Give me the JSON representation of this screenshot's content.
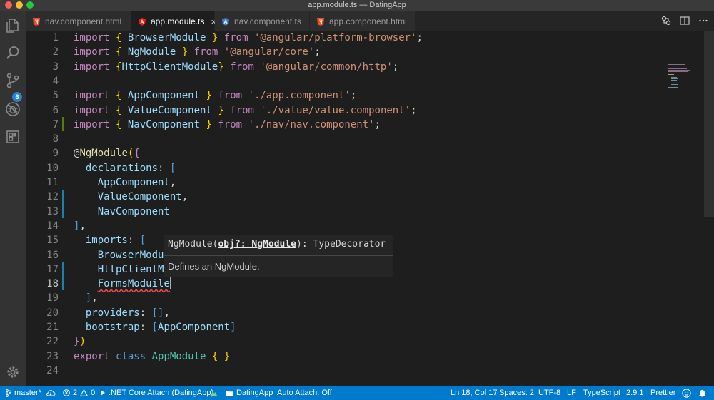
{
  "window": {
    "title": "app.module.ts — DatingApp"
  },
  "activity": {
    "scm_badge": "6"
  },
  "tabs": [
    {
      "label": "nav.component.html",
      "type": "html",
      "active": false
    },
    {
      "label": "app.module.ts",
      "type": "angular",
      "active": true,
      "close": "×"
    },
    {
      "label": "nav.component.ts",
      "type": "angular",
      "active": false
    },
    {
      "label": "app.component.html",
      "type": "html",
      "active": false
    }
  ],
  "editor": {
    "lines": [
      {
        "n": "1",
        "tokens": [
          [
            "kw",
            "import"
          ],
          [
            "pun",
            " "
          ],
          [
            "br",
            "{"
          ],
          [
            "pun",
            " "
          ],
          [
            "id",
            "BrowserModule"
          ],
          [
            "pun",
            " "
          ],
          [
            "br",
            "}"
          ],
          [
            "pun",
            " "
          ],
          [
            "kw",
            "from"
          ],
          [
            "pun",
            " "
          ],
          [
            "str",
            "'@angular/platform-browser'"
          ],
          [
            "pun",
            ";"
          ]
        ]
      },
      {
        "n": "2",
        "tokens": [
          [
            "kw",
            "import"
          ],
          [
            "pun",
            " "
          ],
          [
            "br",
            "{"
          ],
          [
            "pun",
            " "
          ],
          [
            "id",
            "NgModule"
          ],
          [
            "pun",
            " "
          ],
          [
            "br",
            "}"
          ],
          [
            "pun",
            " "
          ],
          [
            "kw",
            "from"
          ],
          [
            "pun",
            " "
          ],
          [
            "str",
            "'@angular/core'"
          ],
          [
            "pun",
            ";"
          ]
        ]
      },
      {
        "n": "3",
        "tokens": [
          [
            "kw",
            "import"
          ],
          [
            "pun",
            " "
          ],
          [
            "br",
            "{"
          ],
          [
            "id",
            "HttpClientModule"
          ],
          [
            "br",
            "}"
          ],
          [
            "pun",
            " "
          ],
          [
            "kw",
            "from"
          ],
          [
            "pun",
            " "
          ],
          [
            "str",
            "'@angular/common/http'"
          ],
          [
            "pun",
            ";"
          ]
        ]
      },
      {
        "n": "4",
        "tokens": []
      },
      {
        "n": "5",
        "tokens": [
          [
            "kw",
            "import"
          ],
          [
            "pun",
            " "
          ],
          [
            "br",
            "{"
          ],
          [
            "pun",
            " "
          ],
          [
            "id",
            "AppComponent"
          ],
          [
            "pun",
            " "
          ],
          [
            "br",
            "}"
          ],
          [
            "pun",
            " "
          ],
          [
            "kw",
            "from"
          ],
          [
            "pun",
            " "
          ],
          [
            "str",
            "'./app.component'"
          ],
          [
            "pun",
            ";"
          ]
        ]
      },
      {
        "n": "6",
        "tokens": [
          [
            "kw",
            "import"
          ],
          [
            "pun",
            " "
          ],
          [
            "br",
            "{"
          ],
          [
            "pun",
            " "
          ],
          [
            "id",
            "ValueComponent"
          ],
          [
            "pun",
            " "
          ],
          [
            "br",
            "}"
          ],
          [
            "pun",
            " "
          ],
          [
            "kw",
            "from"
          ],
          [
            "pun",
            " "
          ],
          [
            "str",
            "'./value/value.component'"
          ],
          [
            "pun",
            ";"
          ]
        ]
      },
      {
        "n": "7",
        "tokens": [
          [
            "kw",
            "import"
          ],
          [
            "pun",
            " "
          ],
          [
            "br",
            "{"
          ],
          [
            "pun",
            " "
          ],
          [
            "id",
            "NavComponent"
          ],
          [
            "pun",
            " "
          ],
          [
            "br",
            "}"
          ],
          [
            "pun",
            " "
          ],
          [
            "kw",
            "from"
          ],
          [
            "pun",
            " "
          ],
          [
            "str",
            "'./nav/nav.component'"
          ],
          [
            "pun",
            ";"
          ]
        ]
      },
      {
        "n": "8",
        "tokens": []
      },
      {
        "n": "9",
        "tokens": [
          [
            "pun",
            "@"
          ],
          [
            "dec",
            "NgModule"
          ],
          [
            "br",
            "("
          ],
          [
            "kw",
            "{"
          ]
        ]
      },
      {
        "n": "10",
        "tokens": [
          [
            "pun",
            "  "
          ],
          [
            "id",
            "declarations"
          ],
          [
            "pun",
            ": "
          ],
          [
            "kw2",
            "["
          ]
        ]
      },
      {
        "n": "11",
        "tokens": [
          [
            "pun",
            "    "
          ],
          [
            "id",
            "AppComponent"
          ],
          [
            "pun",
            ","
          ]
        ]
      },
      {
        "n": "12",
        "tokens": [
          [
            "pun",
            "    "
          ],
          [
            "id",
            "ValueComponent"
          ],
          [
            "pun",
            ","
          ]
        ]
      },
      {
        "n": "13",
        "tokens": [
          [
            "pun",
            "    "
          ],
          [
            "id",
            "NavComponent"
          ]
        ]
      },
      {
        "n": "14",
        "tokens": [
          [
            "kw2",
            "]"
          ],
          [
            "pun",
            ","
          ]
        ]
      },
      {
        "n": "15",
        "tokens": [
          [
            "pun",
            "  "
          ],
          [
            "id",
            "imports"
          ],
          [
            "pun",
            ": "
          ],
          [
            "kw2",
            "["
          ]
        ]
      },
      {
        "n": "16",
        "tokens": [
          [
            "pun",
            "    "
          ],
          [
            "id",
            "BrowserModul"
          ]
        ]
      },
      {
        "n": "17",
        "tokens": [
          [
            "pun",
            "    "
          ],
          [
            "id",
            "HttpClientMo"
          ]
        ]
      },
      {
        "n": "18",
        "tokens": [
          [
            "pun",
            "    "
          ],
          [
            "id",
            "FormsModuile"
          ]
        ],
        "cursor": true,
        "current": true
      },
      {
        "n": "19",
        "tokens": [
          [
            "pun",
            "  "
          ],
          [
            "kw2",
            "]"
          ],
          [
            "pun",
            ","
          ]
        ]
      },
      {
        "n": "20",
        "tokens": [
          [
            "pun",
            "  "
          ],
          [
            "id",
            "providers"
          ],
          [
            "pun",
            ": "
          ],
          [
            "kw2",
            "[]"
          ],
          [
            "pun",
            ","
          ]
        ]
      },
      {
        "n": "21",
        "tokens": [
          [
            "pun",
            "  "
          ],
          [
            "id",
            "bootstrap"
          ],
          [
            "pun",
            ": "
          ],
          [
            "kw2",
            "["
          ],
          [
            "id",
            "AppComponent"
          ],
          [
            "kw2",
            "]"
          ]
        ]
      },
      {
        "n": "22",
        "tokens": [
          [
            "kw",
            "}"
          ],
          [
            "br",
            ")"
          ]
        ]
      },
      {
        "n": "23",
        "tokens": [
          [
            "kw",
            "export"
          ],
          [
            "pun",
            " "
          ],
          [
            "kw2",
            "class"
          ],
          [
            "pun",
            " "
          ],
          [
            "cls",
            "AppModule"
          ],
          [
            "pun",
            " "
          ],
          [
            "br",
            "{"
          ],
          [
            "pun",
            " "
          ],
          [
            "br",
            "}"
          ]
        ]
      },
      {
        "n": "24",
        "tokens": []
      }
    ]
  },
  "hover": {
    "sig_prefix": "NgModule(",
    "sig_param": "obj?: NgModule",
    "sig_suffix": "): TypeDecorator",
    "doc": "Defines an NgModule."
  },
  "status": {
    "branch": "master*",
    "errors": "2",
    "warnings": "0",
    "debug": ".NET Core Attach (DatingApp)",
    "folder": "DatingApp",
    "auto_attach": "Auto Attach: Off",
    "position": "Ln 18, Col 17",
    "spaces": "Spaces: 2",
    "encoding": "UTF-8",
    "eol": "LF",
    "language": "TypeScript",
    "version": "2.9.1",
    "formatter": "Prettier"
  },
  "colors": {
    "accent": "#007acc",
    "activity_bg": "#333333",
    "editor_bg": "#1e1e1e"
  }
}
